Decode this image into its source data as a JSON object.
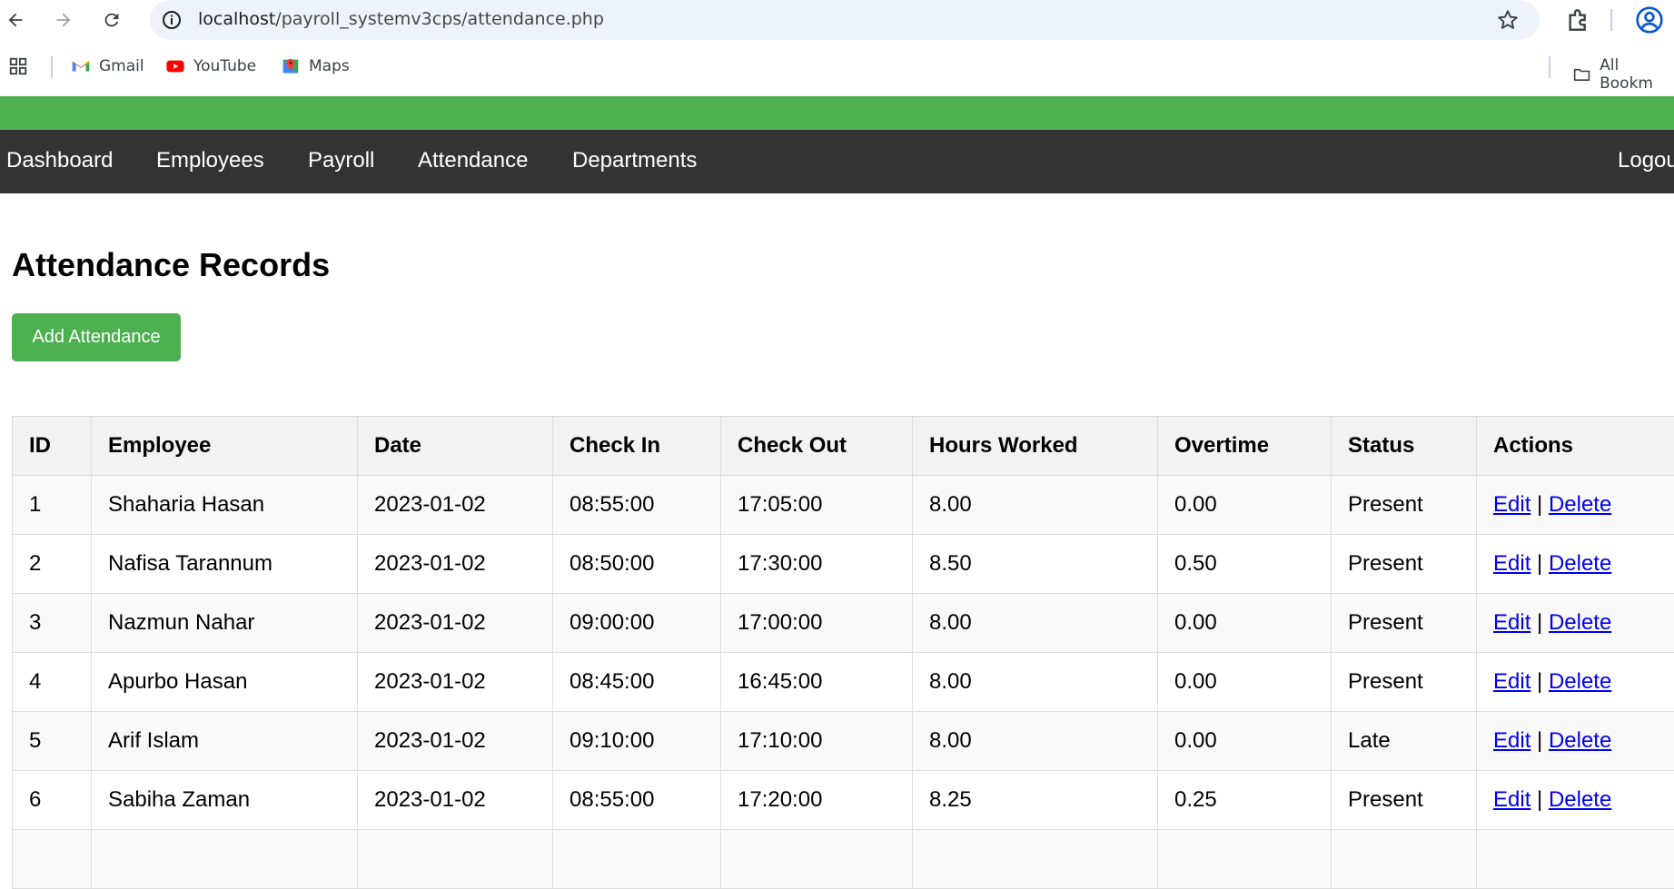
{
  "browser": {
    "url_host": "localhost",
    "url_path": "/payroll_systemv3cps/attendance.php",
    "bookmarks": [
      {
        "label": "Gmail",
        "icon": "gmail-icon"
      },
      {
        "label": "YouTube",
        "icon": "youtube-icon"
      },
      {
        "label": "Maps",
        "icon": "maps-icon"
      }
    ],
    "all_bookmarks_label": "All Bookm"
  },
  "nav": {
    "items": [
      "Dashboard",
      "Employees",
      "Payroll",
      "Attendance",
      "Departments"
    ],
    "logout": "Logou"
  },
  "page": {
    "title": "Attendance Records",
    "add_button": "Add Attendance"
  },
  "table": {
    "headers": [
      "ID",
      "Employee",
      "Date",
      "Check In",
      "Check Out",
      "Hours Worked",
      "Overtime",
      "Status",
      "Actions"
    ],
    "edit_label": "Edit",
    "separator": "|",
    "delete_label": "Delete",
    "rows": [
      {
        "id": "1",
        "employee": "Shaharia Hasan",
        "date": "2023-01-02",
        "check_in": "08:55:00",
        "check_out": "17:05:00",
        "hours": "8.00",
        "overtime": "0.00",
        "status": "Present"
      },
      {
        "id": "2",
        "employee": "Nafisa Tarannum",
        "date": "2023-01-02",
        "check_in": "08:50:00",
        "check_out": "17:30:00",
        "hours": "8.50",
        "overtime": "0.50",
        "status": "Present"
      },
      {
        "id": "3",
        "employee": "Nazmun Nahar",
        "date": "2023-01-02",
        "check_in": "09:00:00",
        "check_out": "17:00:00",
        "hours": "8.00",
        "overtime": "0.00",
        "status": "Present"
      },
      {
        "id": "4",
        "employee": "Apurbo Hasan",
        "date": "2023-01-02",
        "check_in": "08:45:00",
        "check_out": "16:45:00",
        "hours": "8.00",
        "overtime": "0.00",
        "status": "Present"
      },
      {
        "id": "5",
        "employee": "Arif Islam",
        "date": "2023-01-02",
        "check_in": "09:10:00",
        "check_out": "17:10:00",
        "hours": "8.00",
        "overtime": "0.00",
        "status": "Late"
      },
      {
        "id": "6",
        "employee": "Sabiha Zaman",
        "date": "2023-01-02",
        "check_in": "08:55:00",
        "check_out": "17:20:00",
        "hours": "8.25",
        "overtime": "0.25",
        "status": "Present"
      },
      {
        "id": "",
        "employee": "",
        "date": "",
        "check_in": "",
        "check_out": "",
        "hours": "",
        "overtime": "",
        "status": ""
      }
    ]
  },
  "colors": {
    "accent_green": "#4caf50",
    "nav_bg": "#333333",
    "link": "#0000ee"
  }
}
